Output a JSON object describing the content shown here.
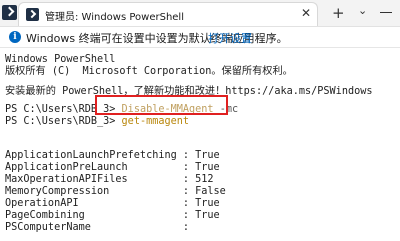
{
  "window": {
    "tab_title": "管理员: Windows PowerShell",
    "tab_close": "✕",
    "new_tab": "+",
    "dropdown": "⌄"
  },
  "infobar": {
    "message": "Windows 终端可在设置中设置为默认终端应用程序。",
    "link": "打开设置"
  },
  "console": {
    "header_line1": "Windows PowerShell",
    "header_line2": "版权所有 (C)  Microsoft Corporation。保留所有权利。",
    "header_line3": "安装最新的 PowerShell，了解新功能和改进！https://aka.ms/PSWindows",
    "prompt1": "PS C:\\Users\\RDB_3> ",
    "cmd1": "Disable-MMAgent",
    "cmd1_param": " -mc",
    "prompt2": "PS C:\\Users\\RDB_3> ",
    "cmd2": "get-mmagent",
    "output": [
      {
        "key": "ApplicationLaunchPrefetching",
        "value": "True"
      },
      {
        "key": "ApplicationPreLaunch",
        "value": "True"
      },
      {
        "key": "MaxOperationAPIFiles",
        "value": "512"
      },
      {
        "key": "MemoryCompression",
        "value": "False"
      },
      {
        "key": "OperationAPI",
        "value": "True"
      },
      {
        "key": "PageCombining",
        "value": "True"
      },
      {
        "key": "PSComputerName",
        "value": ""
      }
    ],
    "output_lines": [
      "ApplicationLaunchPrefetching : True",
      "ApplicationPreLaunch         : True",
      "MaxOperationAPIFiles         : 512",
      "MemoryCompression            : False",
      "OperationAPI                 : True",
      "PageCombining                : True",
      "PSComputerName               :"
    ]
  },
  "colors": {
    "accent": "#0067c0",
    "command": "#b8860b",
    "highlight_border": "#e02020",
    "titlebar": "#f3f3f3"
  }
}
